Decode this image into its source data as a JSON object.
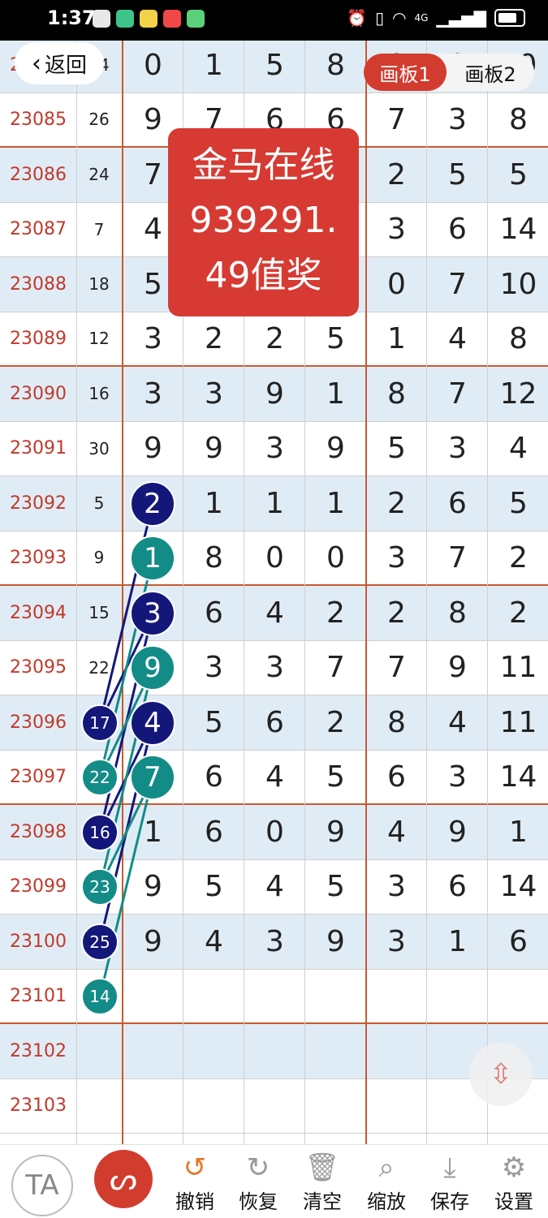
{
  "status_bar": {
    "time": "1:37",
    "network": "4G",
    "app_colors": [
      "#e8e8e8",
      "#3cc48a",
      "#f3d24a",
      "#f04848",
      "#5ad07a"
    ]
  },
  "header": {
    "back_label": "返回",
    "tabs": [
      {
        "label": "画板1",
        "active": true
      },
      {
        "label": "画板2",
        "active": false
      }
    ]
  },
  "promo": {
    "lines": [
      "金马在线",
      "939291.",
      "49值奖"
    ]
  },
  "rows": [
    {
      "issue": "23084",
      "sum": "14",
      "nums": [
        "0",
        "1",
        "5",
        "8",
        "0",
        "0",
        "10"
      ],
      "shade": true
    },
    {
      "issue": "23085",
      "sum": "26",
      "nums": [
        "9",
        "7",
        "6",
        "6",
        "7",
        "3",
        "8"
      ],
      "shade": false
    },
    {
      "issue": "23086",
      "sum": "24",
      "nums": [
        "7",
        "",
        "",
        "",
        "2",
        "5",
        "5"
      ],
      "shade": true
    },
    {
      "issue": "23087",
      "sum": "7",
      "nums": [
        "4",
        "",
        "",
        "",
        "3",
        "6",
        "14"
      ],
      "shade": false
    },
    {
      "issue": "23088",
      "sum": "18",
      "nums": [
        "5",
        "",
        "",
        "",
        "0",
        "7",
        "10"
      ],
      "shade": true
    },
    {
      "issue": "23089",
      "sum": "12",
      "nums": [
        "3",
        "2",
        "2",
        "5",
        "1",
        "4",
        "8"
      ],
      "shade": false
    },
    {
      "issue": "23090",
      "sum": "16",
      "nums": [
        "3",
        "3",
        "9",
        "1",
        "8",
        "7",
        "12"
      ],
      "shade": true
    },
    {
      "issue": "23091",
      "sum": "30",
      "nums": [
        "9",
        "9",
        "3",
        "9",
        "5",
        "3",
        "4"
      ],
      "shade": false
    },
    {
      "issue": "23092",
      "sum": "5",
      "nums": [
        "",
        "1",
        "1",
        "1",
        "2",
        "6",
        "5"
      ],
      "shade": true
    },
    {
      "issue": "23093",
      "sum": "9",
      "nums": [
        "",
        "8",
        "0",
        "0",
        "3",
        "7",
        "2"
      ],
      "shade": false
    },
    {
      "issue": "23094",
      "sum": "15",
      "nums": [
        "",
        "6",
        "4",
        "2",
        "2",
        "8",
        "2"
      ],
      "shade": true
    },
    {
      "issue": "23095",
      "sum": "22",
      "nums": [
        "",
        "3",
        "3",
        "7",
        "7",
        "9",
        "11"
      ],
      "shade": false
    },
    {
      "issue": "23096",
      "sum": "",
      "nums": [
        "",
        "5",
        "6",
        "2",
        "8",
        "4",
        "11"
      ],
      "shade": true
    },
    {
      "issue": "23097",
      "sum": "",
      "nums": [
        "",
        "6",
        "4",
        "5",
        "6",
        "3",
        "14"
      ],
      "shade": false
    },
    {
      "issue": "23098",
      "sum": "",
      "nums": [
        "1",
        "6",
        "0",
        "9",
        "4",
        "9",
        "1"
      ],
      "shade": true
    },
    {
      "issue": "23099",
      "sum": "",
      "nums": [
        "9",
        "5",
        "4",
        "5",
        "3",
        "6",
        "14"
      ],
      "shade": false
    },
    {
      "issue": "23100",
      "sum": "",
      "nums": [
        "9",
        "4",
        "3",
        "9",
        "3",
        "1",
        "6"
      ],
      "shade": true
    },
    {
      "issue": "23101",
      "sum": "",
      "nums": [
        "",
        "",
        "",
        "",
        "",
        "",
        ""
      ],
      "shade": false
    },
    {
      "issue": "23102",
      "sum": "",
      "nums": [
        "",
        "",
        "",
        "",
        "",
        "",
        ""
      ],
      "shade": true
    },
    {
      "issue": "23103",
      "sum": "",
      "nums": [
        "",
        "",
        "",
        "",
        "",
        "",
        ""
      ],
      "shade": false
    }
  ],
  "group_end_rows": [
    1,
    5,
    9,
    13,
    17
  ],
  "balls_big": [
    {
      "row": 8,
      "value": "2",
      "color": "navy"
    },
    {
      "row": 9,
      "value": "1",
      "color": "teal"
    },
    {
      "row": 10,
      "value": "3",
      "color": "navy"
    },
    {
      "row": 11,
      "value": "9",
      "color": "teal"
    },
    {
      "row": 12,
      "value": "4",
      "color": "navy"
    },
    {
      "row": 13,
      "value": "7",
      "color": "teal"
    }
  ],
  "balls_small": [
    {
      "row": 12,
      "value": "17",
      "color": "navy"
    },
    {
      "row": 13,
      "value": "22",
      "color": "teal"
    },
    {
      "row": 14,
      "value": "16",
      "color": "navy"
    },
    {
      "row": 15,
      "value": "23",
      "color": "teal"
    },
    {
      "row": 16,
      "value": "25",
      "color": "navy"
    },
    {
      "row": 17,
      "value": "14",
      "color": "teal"
    }
  ],
  "colors": {
    "navy": "#14177a",
    "teal": "#138c88",
    "accent_red": "#d23c2e"
  },
  "toolbar": {
    "ta_label": "TA",
    "tools": [
      {
        "name": "undo",
        "label": "撤销",
        "icon": "undo-icon"
      },
      {
        "name": "redo",
        "label": "恢复",
        "icon": "redo-icon"
      },
      {
        "name": "clear",
        "label": "清空",
        "icon": "trash-icon"
      },
      {
        "name": "zoom",
        "label": "缩放",
        "icon": "zoom-icon"
      },
      {
        "name": "save",
        "label": "保存",
        "icon": "download-icon"
      },
      {
        "name": "settings",
        "label": "设置",
        "icon": "gear-icon"
      }
    ]
  }
}
